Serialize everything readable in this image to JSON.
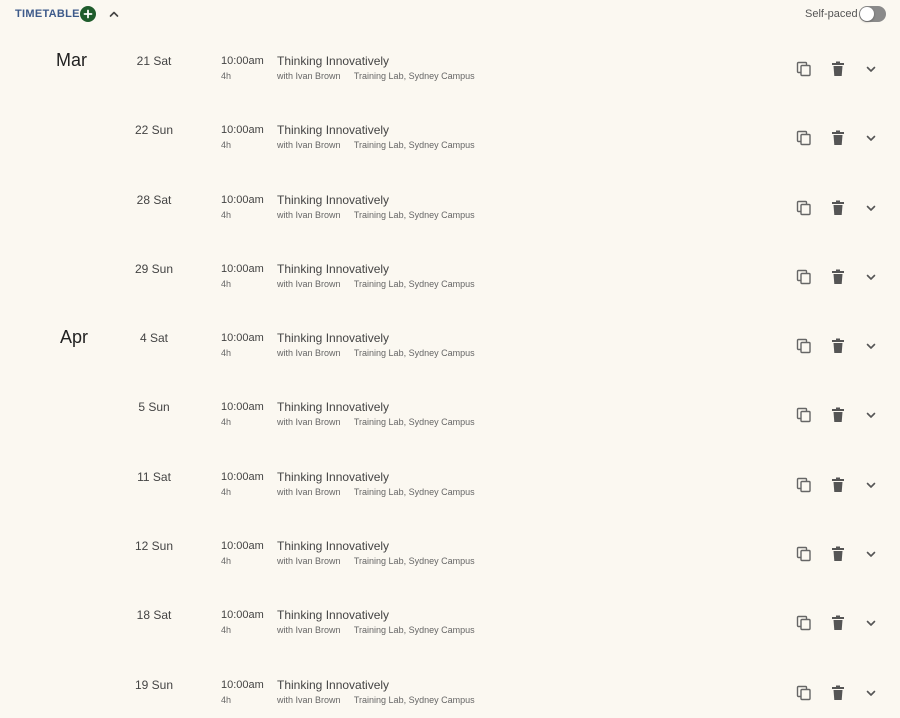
{
  "header": {
    "title": "TIMETABLE",
    "self_paced_label": "Self-paced",
    "self_paced_on": false
  },
  "colors": {
    "background": "#fbf8f1",
    "title": "#3d5a8a",
    "add_button": "#1f5c2c",
    "toggle_off": "#8a8a8a",
    "icon": "#666666"
  },
  "icons": {
    "add": "plus-circle-icon",
    "collapse": "chevron-up-icon",
    "copy": "copy-icon",
    "delete": "trash-icon",
    "expand": "chevron-down-icon"
  },
  "sessions": [
    {
      "month": "Mar",
      "date": "21 Sat",
      "time": "10:00am",
      "duration": "4h",
      "course": "Thinking Innovatively",
      "instructor": "with Ivan Brown",
      "location": "Training Lab, Sydney Campus"
    },
    {
      "month": "",
      "date": "22 Sun",
      "time": "10:00am",
      "duration": "4h",
      "course": "Thinking Innovatively",
      "instructor": "with Ivan Brown",
      "location": "Training Lab, Sydney Campus"
    },
    {
      "month": "",
      "date": "28 Sat",
      "time": "10:00am",
      "duration": "4h",
      "course": "Thinking Innovatively",
      "instructor": "with Ivan Brown",
      "location": "Training Lab, Sydney Campus"
    },
    {
      "month": "",
      "date": "29 Sun",
      "time": "10:00am",
      "duration": "4h",
      "course": "Thinking Innovatively",
      "instructor": "with Ivan Brown",
      "location": "Training Lab, Sydney Campus"
    },
    {
      "month": "Apr",
      "date": "4 Sat",
      "time": "10:00am",
      "duration": "4h",
      "course": "Thinking Innovatively",
      "instructor": "with Ivan Brown",
      "location": "Training Lab, Sydney Campus"
    },
    {
      "month": "",
      "date": "5 Sun",
      "time": "10:00am",
      "duration": "4h",
      "course": "Thinking Innovatively",
      "instructor": "with Ivan Brown",
      "location": "Training Lab, Sydney Campus"
    },
    {
      "month": "",
      "date": "11 Sat",
      "time": "10:00am",
      "duration": "4h",
      "course": "Thinking Innovatively",
      "instructor": "with Ivan Brown",
      "location": "Training Lab, Sydney Campus"
    },
    {
      "month": "",
      "date": "12 Sun",
      "time": "10:00am",
      "duration": "4h",
      "course": "Thinking Innovatively",
      "instructor": "with Ivan Brown",
      "location": "Training Lab, Sydney Campus"
    },
    {
      "month": "",
      "date": "18 Sat",
      "time": "10:00am",
      "duration": "4h",
      "course": "Thinking Innovatively",
      "instructor": "with Ivan Brown",
      "location": "Training Lab, Sydney Campus"
    },
    {
      "month": "",
      "date": "19 Sun",
      "time": "10:00am",
      "duration": "4h",
      "course": "Thinking Innovatively",
      "instructor": "with Ivan Brown",
      "location": "Training Lab, Sydney Campus"
    }
  ]
}
